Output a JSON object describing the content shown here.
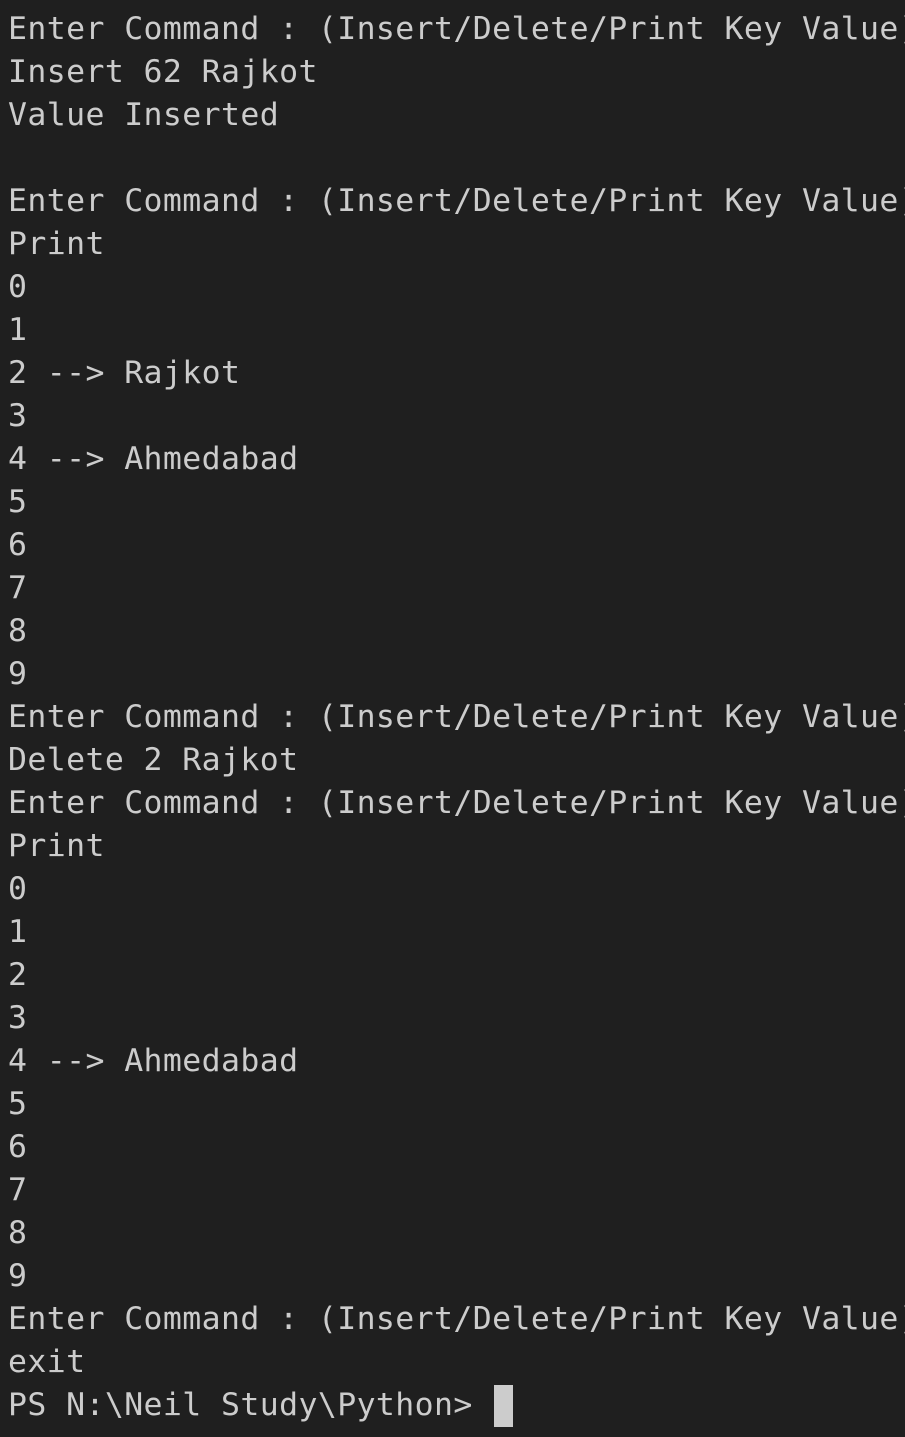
{
  "terminal": {
    "lines": [
      "Enter Command : (Insert/Delete/Print Key Value)",
      "Insert 62 Rajkot",
      "Value Inserted",
      "",
      "Enter Command : (Insert/Delete/Print Key Value)",
      "Print",
      "0",
      "1",
      "2 --> Rajkot",
      "3",
      "4 --> Ahmedabad",
      "5",
      "6",
      "7",
      "8",
      "9",
      "Enter Command : (Insert/Delete/Print Key Value)",
      "Delete 2 Rajkot",
      "Enter Command : (Insert/Delete/Print Key Value)",
      "Print",
      "0",
      "1",
      "2",
      "3",
      "4 --> Ahmedabad",
      "5",
      "6",
      "7",
      "8",
      "9",
      "Enter Command : (Insert/Delete/Print Key Value)",
      "exit"
    ],
    "prompt": "PS N:\\Neil Study\\Python> "
  },
  "colors": {
    "background": "#1f1f1f",
    "foreground": "#cccccc"
  }
}
